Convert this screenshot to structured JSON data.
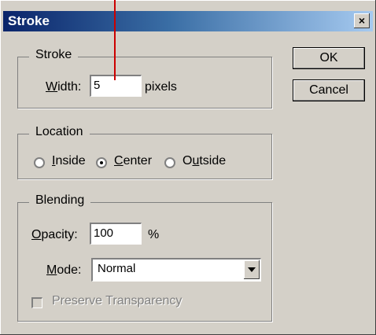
{
  "window": {
    "title": "Stroke",
    "close_label": "×"
  },
  "stroke_group": {
    "legend": "Stroke",
    "width_label": "Width:",
    "width_value": "5",
    "unit": "pixels"
  },
  "location_group": {
    "legend": "Location",
    "options": [
      {
        "label": "Inside",
        "checked": false
      },
      {
        "label": "Center",
        "checked": true
      },
      {
        "label": "Outside",
        "checked": false
      }
    ]
  },
  "blending_group": {
    "legend": "Blending",
    "opacity_label": "Opacity:",
    "opacity_value": "100",
    "opacity_unit": "%",
    "mode_label": "Mode:",
    "mode_value": "Normal",
    "preserve_label": "Preserve Transparency",
    "preserve_checked": false
  },
  "buttons": {
    "ok": "OK",
    "cancel": "Cancel"
  }
}
